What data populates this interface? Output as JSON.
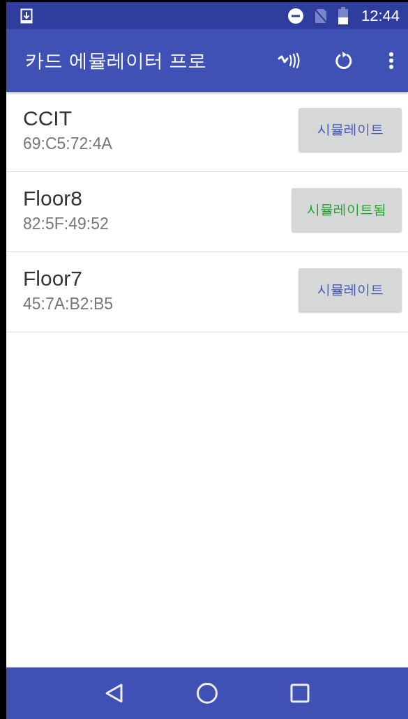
{
  "status_bar": {
    "time": "12:44"
  },
  "app_bar": {
    "title": "카드 에뮬레이터 프로"
  },
  "cards": [
    {
      "name": "CCIT",
      "uid": "69:C5:72:4A",
      "button": "시뮬레이트",
      "simulated": false
    },
    {
      "name": "Floor8",
      "uid": "82:5F:49:52",
      "button": "시뮬레이트됨",
      "simulated": true
    },
    {
      "name": "Floor7",
      "uid": "45:7A:B2:B5",
      "button": "시뮬레이트",
      "simulated": false
    }
  ]
}
